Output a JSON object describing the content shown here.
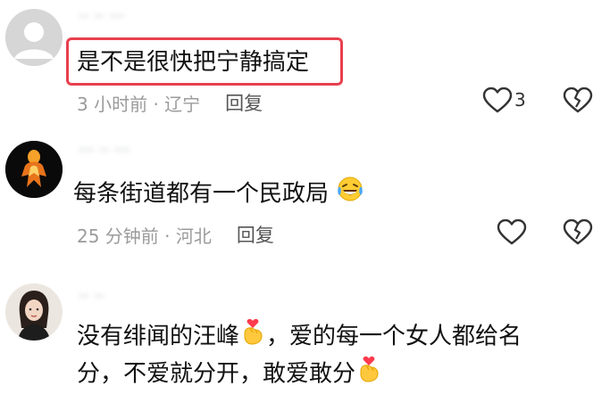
{
  "comments": [
    {
      "username": "·· ·· ···",
      "text": "是不是很快把宁静搞定",
      "time_location": "3 小时前 · 辽宁",
      "reply_label": "回复",
      "like_count": "3",
      "avatar": "default-avatar"
    },
    {
      "username": "··· ·· ···",
      "text": "每条街道都有一个民政局",
      "emoji": "laughing-crying-emoji",
      "time_location": "25 分钟前 · 河北",
      "reply_label": "回复",
      "avatar": "fire-figure-avatar"
    },
    {
      "username": "·· ··",
      "text_line1_a": "没有绯闻的汪峰",
      "text_line1_b": "，爱的每一个女人都给名",
      "text_line2_a": "分，不爱就分开，敢爱敢分",
      "emoji": "finger-heart-emoji",
      "avatar": "woman-photo-avatar"
    }
  ],
  "colors": {
    "highlight_border": "#e8404f",
    "meta_text": "#9b9b9b",
    "body_text": "#111111"
  }
}
